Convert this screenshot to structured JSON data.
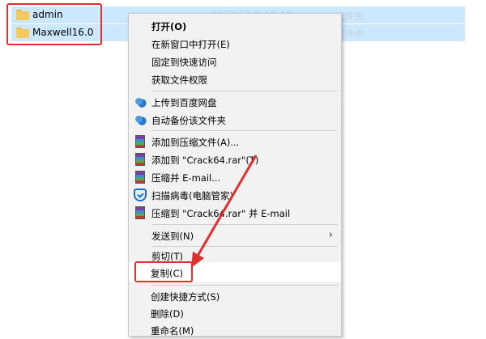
{
  "files": [
    {
      "name": "admin",
      "date": "2020/10/8 10:40",
      "type": "文件夹"
    },
    {
      "name": "Maxwell16.0",
      "date": "",
      "type": "文件夹"
    }
  ],
  "menu": {
    "open": "打开(O)",
    "open_new_window": "在新窗口中打开(E)",
    "pin_quick_access": "固定到快速访问",
    "get_permission": "获取文件权限",
    "upload_baidu": "上传到百度网盘",
    "auto_backup": "自动备份该文件夹",
    "add_archive": "添加到压缩文件(A)...",
    "add_to_rar": "添加到 \"Crack64.rar\"(T)",
    "compress_email": "压缩并 E-mail...",
    "scan_virus": "扫描病毒(电脑管家)",
    "compress_rar_email": "压缩到 \"Crack64.rar\" 并 E-mail",
    "send_to": "发送到(N)",
    "cut": "剪切(T)",
    "copy": "复制(C)",
    "create_shortcut": "创建快捷方式(S)",
    "delete": "删除(D)",
    "rename": "重命名(M)"
  },
  "colors": {
    "selection": "#cce8ff",
    "highlight": "#e0302e",
    "menu_bg": "#f2f2f2"
  }
}
